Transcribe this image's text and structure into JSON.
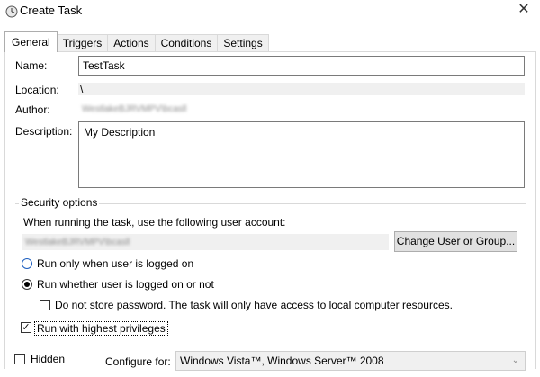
{
  "window": {
    "title": "Create Task",
    "close_glyph": "✕"
  },
  "tabs": [
    {
      "label": "General",
      "active": true
    },
    {
      "label": "Triggers"
    },
    {
      "label": "Actions"
    },
    {
      "label": "Conditions"
    },
    {
      "label": "Settings"
    }
  ],
  "general": {
    "name_label": "Name:",
    "name_value": "TestTask",
    "location_label": "Location:",
    "location_value": "\\",
    "author_label": "Author:",
    "author_value": "WestlakeBJRVMPV\\bcasll",
    "description_label": "Description:",
    "description_value": "My Description"
  },
  "security": {
    "title": "Security options",
    "account_prompt": "When running the task, use the following user account:",
    "account_value": "WestlakeBJRVMPV\\bcasll",
    "change_button": "Change User or Group...",
    "radio_logged_on": "Run only when user is logged on",
    "radio_whether": "Run whether user is logged on or not",
    "radio_selected": "whether",
    "no_store_password": "Do not store password.  The task will only have access to local computer resources.",
    "highest_privileges": "Run with highest privileges",
    "highest_checked": true,
    "check_glyph": "✓"
  },
  "footer": {
    "hidden_label": "Hidden",
    "configure_label": "Configure for:",
    "configure_value": "Windows Vista™, Windows Server™ 2008",
    "dropdown_glyph": "⌄"
  },
  "colors": {
    "radio_focus": "#1e5fbf",
    "panel_border": "#d9d9d9",
    "readonly_bg": "#f0f0f0"
  },
  "icons": {
    "title": "clock-icon",
    "close": "close-icon"
  }
}
